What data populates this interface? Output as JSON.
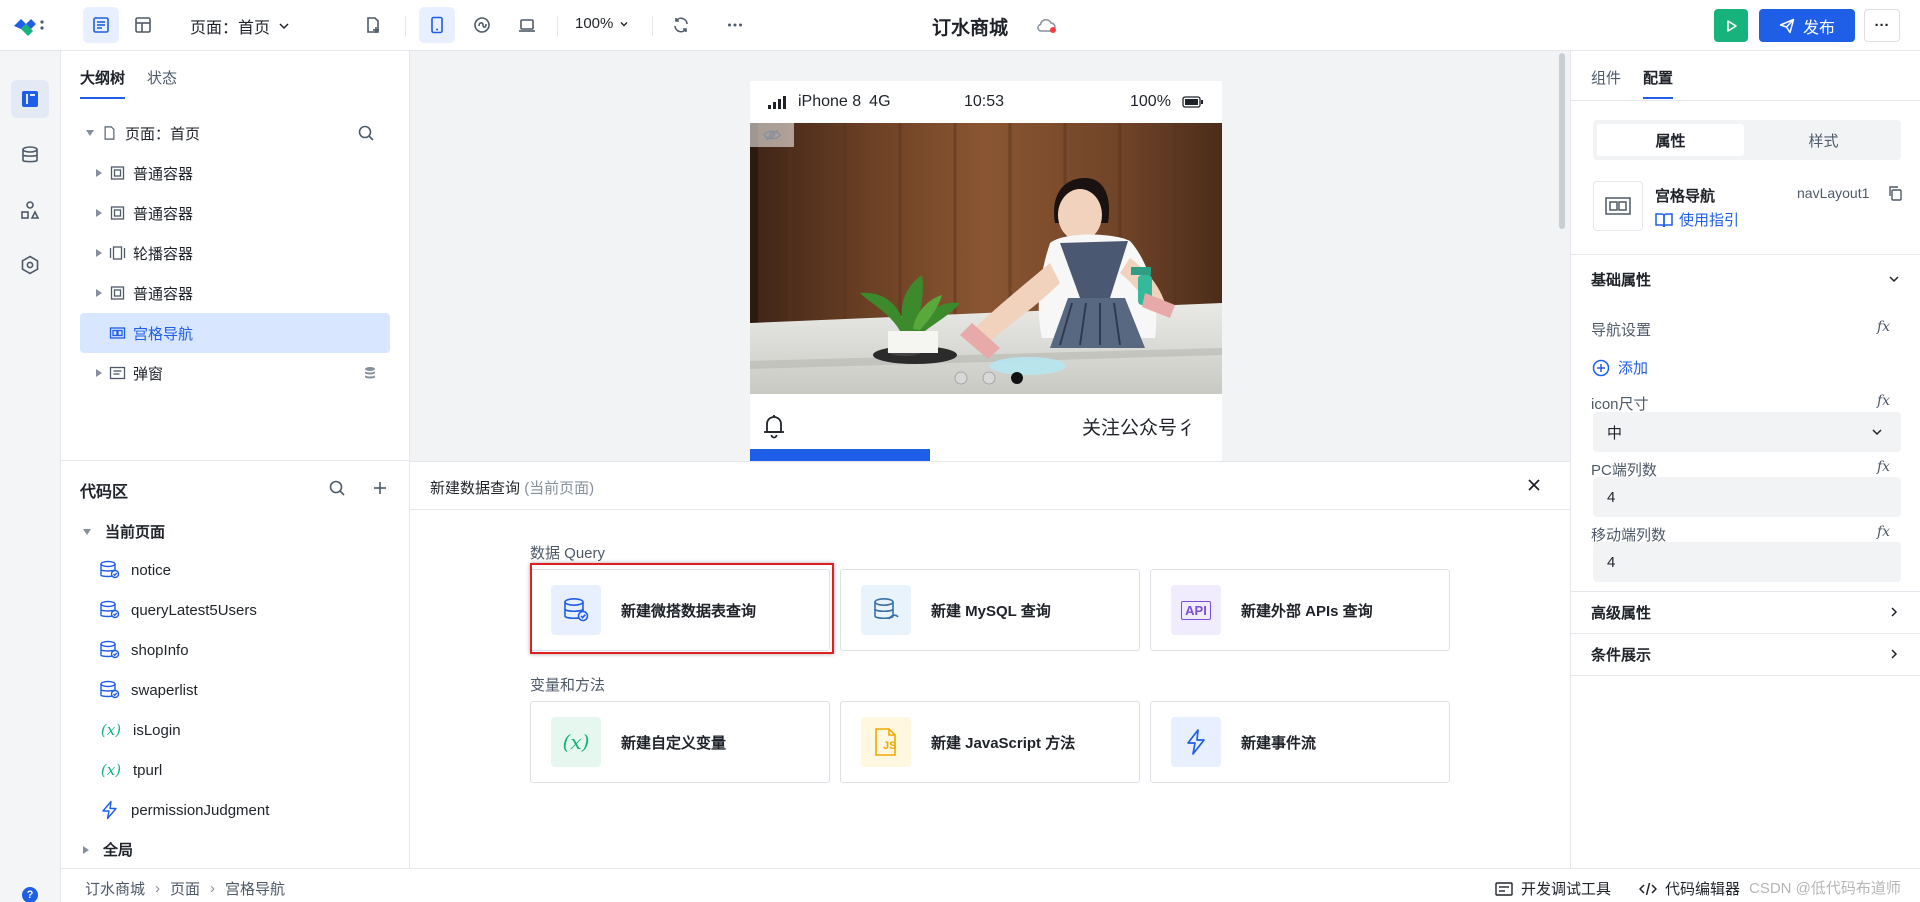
{
  "topbar": {
    "page_select": "页面：首页",
    "zoom": "100%",
    "app_title": "订水商城",
    "publish": "发布",
    "more": "···"
  },
  "outline": {
    "tabs": [
      "大纲树",
      "状态"
    ],
    "root": "页面：首页",
    "items": [
      {
        "label": "普通容器",
        "icon": "container-icon"
      },
      {
        "label": "普通容器",
        "icon": "container-icon"
      },
      {
        "label": "轮播容器",
        "icon": "carousel-icon"
      },
      {
        "label": "普通容器",
        "icon": "container-icon"
      },
      {
        "label": "宫格导航",
        "icon": "grid-nav-icon",
        "selected": true
      },
      {
        "label": "弹窗",
        "icon": "dialog-icon"
      }
    ]
  },
  "code": {
    "title": "代码区",
    "group_current": "当前页面",
    "items": [
      {
        "label": "notice",
        "type": "query"
      },
      {
        "label": "queryLatest5Users",
        "type": "query"
      },
      {
        "label": "shopInfo",
        "type": "query"
      },
      {
        "label": "swaperlist",
        "type": "query"
      },
      {
        "label": "isLogin",
        "type": "var"
      },
      {
        "label": "tpurl",
        "type": "var"
      },
      {
        "label": "permissionJudgment",
        "type": "event"
      }
    ],
    "group_global": "全局"
  },
  "phone": {
    "carrier": "iPhone 8",
    "network": "4G",
    "time": "10:53",
    "battery": "100%",
    "carousel_active_dot": 3,
    "carousel_dot_count": 3,
    "notice_text": "关注公众号彳"
  },
  "dialog": {
    "title": "新建数据查询",
    "subtitle": "(当前页面)",
    "section_query": "数据 Query",
    "section_vars": "变量和方法",
    "cards": [
      {
        "label": "新建微搭数据表查询",
        "icon": "database-query-icon"
      },
      {
        "label": "新建 MySQL 查询",
        "icon": "mysql-icon"
      },
      {
        "label": "新建外部 APIs 查询",
        "icon": "api-icon",
        "icon_text": "API"
      },
      {
        "label": "新建自定义变量",
        "icon": "variable-icon",
        "icon_text": "(x)"
      },
      {
        "label": "新建 JavaScript 方法",
        "icon": "javascript-file-icon",
        "icon_text": "JS"
      },
      {
        "label": "新建事件流",
        "icon": "lightning-icon"
      }
    ]
  },
  "right": {
    "tabs": [
      "组件",
      "配置"
    ],
    "seg": [
      "属性",
      "样式"
    ],
    "component_name": "宫格导航",
    "component_id": "navLayout1",
    "guide": "使用指引",
    "basic": "基础属性",
    "nav_setting": "导航设置",
    "add": "添加",
    "icon_size_label": "icon尺寸",
    "icon_size_value": "中",
    "pc_cols_label": "PC端列数",
    "pc_cols_value": "4",
    "mobile_cols_label": "移动端列数",
    "mobile_cols_value": "4",
    "advanced": "高级属性",
    "condition": "条件展示",
    "fx": "fx"
  },
  "bottombar": {
    "crumbs": [
      "订水商城",
      "页面",
      "宫格导航"
    ],
    "dev_tools": "开发调试工具",
    "code_editor": "代码编辑器",
    "watermark": "CSDN @低代码布道师"
  },
  "colors": {
    "primary": "#1f5ee6",
    "success": "#16b47c",
    "highlight": "#e02020"
  }
}
